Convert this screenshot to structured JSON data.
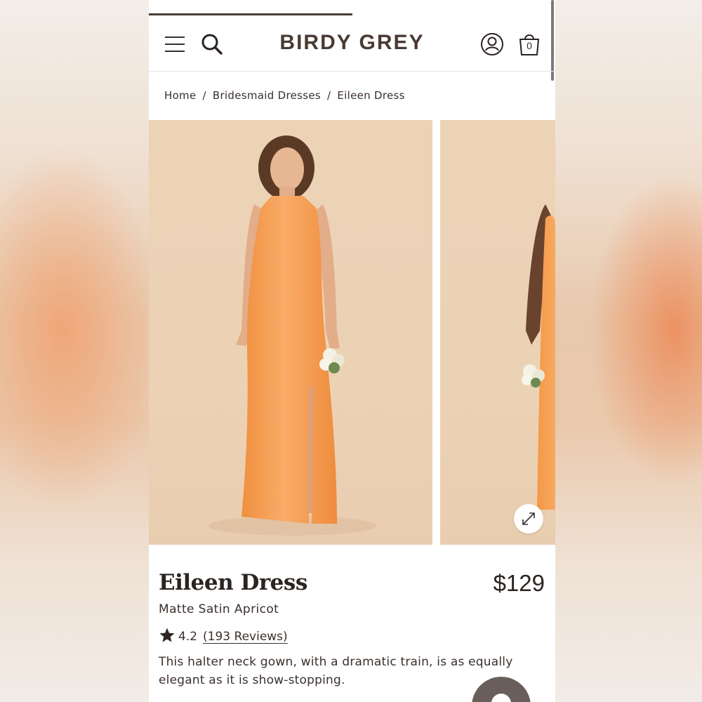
{
  "header": {
    "brand": "BIRDY GREY",
    "bag_count": "0",
    "icons": [
      "menu-icon",
      "search-icon",
      "account-icon",
      "shopping-bag-icon"
    ]
  },
  "breadcrumb": {
    "items": [
      "Home",
      "Bridesmaid Dresses",
      "Eileen Dress"
    ],
    "separator": "/"
  },
  "product": {
    "title": "Eileen Dress",
    "price": "$129",
    "variant": "Matte Satin Apricot",
    "rating": "4.2",
    "reviews": "(193 Reviews)",
    "description": "This halter neck gown, with a dramatic train, is as equally elegant as it is show-stopping."
  },
  "colors": {
    "accent": "#4a3a33",
    "dress": "#f7a35c",
    "photo_background": "#ecd2b5"
  }
}
